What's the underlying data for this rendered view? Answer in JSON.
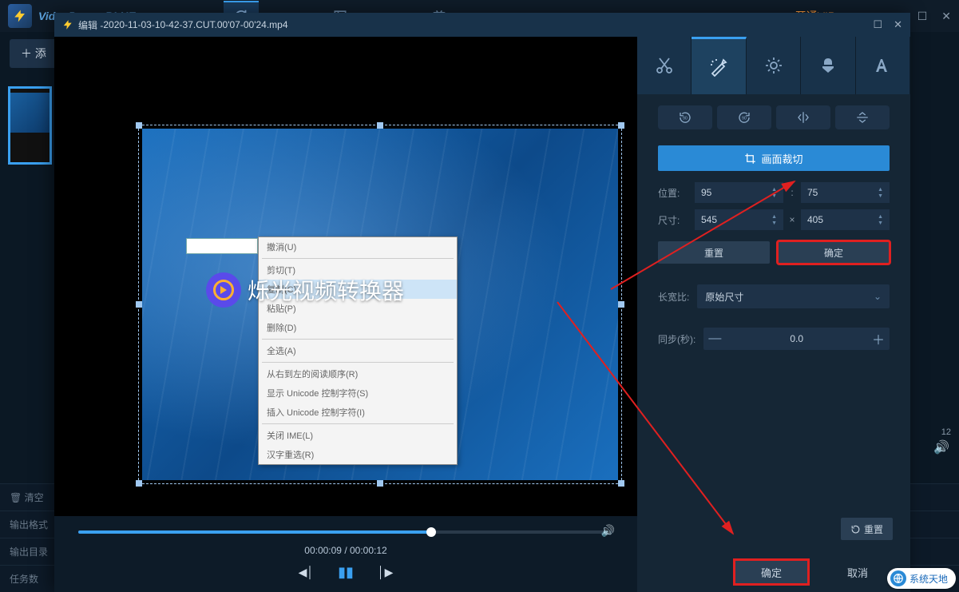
{
  "bg": {
    "title": "VideoPower BLUE",
    "vip": "开通VIP",
    "add_btn": "＋ 添",
    "clear_label": "清空",
    "out_format": "输出格式",
    "out_dir": "输出目录",
    "tasks": "任务数",
    "time_right": "12"
  },
  "modal": {
    "title_prefix": "编辑  -  ",
    "filename": "2020-11-03-10-42-37.CUT.00'07-00'24.mp4"
  },
  "watermark": "烁光视频转换器",
  "context_menu": {
    "items": [
      "撤消(U)",
      "剪切(T)",
      "复制(C)",
      "粘贴(P)",
      "删除(D)",
      "全选(A)"
    ],
    "items2": [
      "从右到左的阅读顺序(R)",
      "显示 Unicode 控制字符(S)",
      "插入 Unicode 控制字符(I)"
    ],
    "items3": [
      "关闭 IME(L)",
      "汉字重选(R)"
    ]
  },
  "time": {
    "current": "00:00:09",
    "total": "00:00:12",
    "sep": " / "
  },
  "crop": {
    "header": "画面裁切",
    "pos_label": "位置:",
    "size_label": "尺寸:",
    "x": "95",
    "y": "75",
    "w": "545",
    "h": "405",
    "reset": "重置",
    "confirm": "确定"
  },
  "aspect": {
    "label": "长宽比:",
    "value": "原始尺寸"
  },
  "sync": {
    "label": "同步(秒):",
    "value": "0.0"
  },
  "reset_bottom": "重置",
  "footer": {
    "ok": "确定",
    "cancel": "取消"
  },
  "badge": "系统天地"
}
